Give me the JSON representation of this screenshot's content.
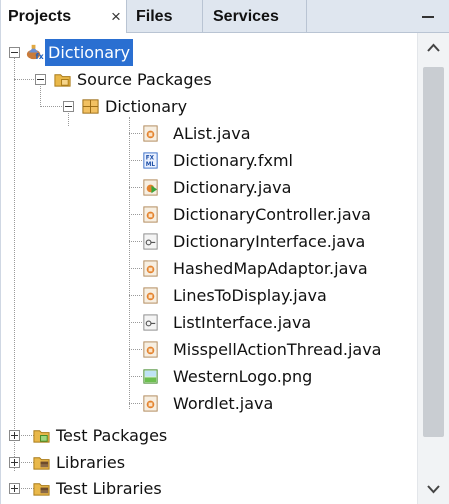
{
  "tabs": {
    "projects": "Projects",
    "files": "Files",
    "services": "Services",
    "close_glyph": "×"
  },
  "tree": {
    "project": "Dictionary",
    "source_packages": "Source Packages",
    "package": "Dictionary",
    "files": [
      {
        "name": "AList.java",
        "icon": "java-class-icon"
      },
      {
        "name": "Dictionary.fxml",
        "icon": "fxml-file-icon"
      },
      {
        "name": "Dictionary.java",
        "icon": "java-main-class-icon"
      },
      {
        "name": "DictionaryController.java",
        "icon": "java-class-icon"
      },
      {
        "name": "DictionaryInterface.java",
        "icon": "java-interface-icon"
      },
      {
        "name": "HashedMapAdaptor.java",
        "icon": "java-class-icon"
      },
      {
        "name": "LinesToDisplay.java",
        "icon": "java-class-icon"
      },
      {
        "name": "ListInterface.java",
        "icon": "java-interface-icon"
      },
      {
        "name": "MisspellActionThread.java",
        "icon": "java-class-icon"
      },
      {
        "name": "WesternLogo.png",
        "icon": "image-file-icon"
      },
      {
        "name": "Wordlet.java",
        "icon": "java-class-icon"
      }
    ],
    "test_packages": "Test Packages",
    "libraries": "Libraries",
    "test_libraries": "Test Libraries"
  },
  "colors": {
    "selection": "#2a6fd1",
    "tabbar": "#dfe6ef"
  }
}
